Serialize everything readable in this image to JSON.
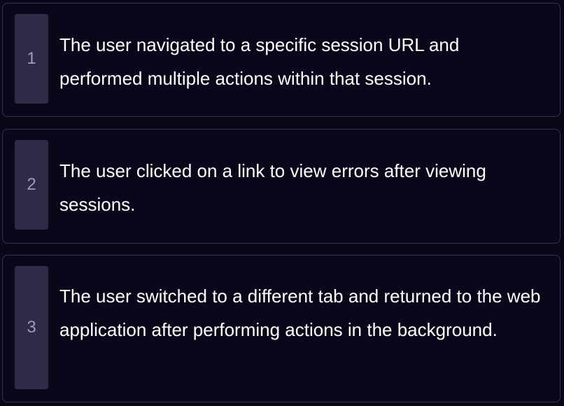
{
  "items": [
    {
      "number": "1",
      "text": "The user navigated to a specific session URL and performed multiple actions within that session."
    },
    {
      "number": "2",
      "text": "The user clicked on a link to view errors after viewing sessions."
    },
    {
      "number": "3",
      "text": "The user switched to a different tab and returned to the web application after performing actions in the background."
    }
  ]
}
